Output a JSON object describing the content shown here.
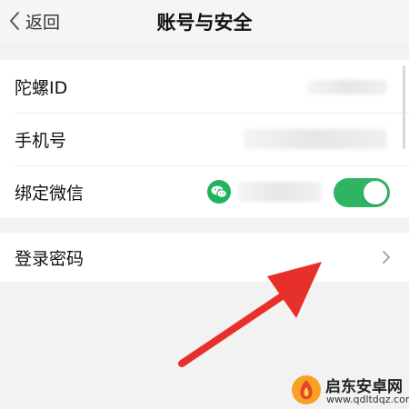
{
  "nav": {
    "back_label": "返回",
    "title": "账号与安全"
  },
  "account": {
    "rows": [
      {
        "label": "陀螺ID"
      },
      {
        "label": "手机号"
      },
      {
        "label": "绑定微信",
        "wechat_bound": true
      }
    ]
  },
  "security": {
    "rows": [
      {
        "label": "登录密码"
      }
    ]
  },
  "watermark": {
    "title": "启东安卓网",
    "url": "www.qdltdqz.com"
  },
  "colors": {
    "toggle_on": "#2fb463",
    "wechat": "#22b35e",
    "arrow": "#e8302b",
    "background": "#f2f2f2"
  },
  "icons": {
    "back": "chevron-left-icon",
    "wechat": "wechat-icon",
    "row_action": "chevron-right-icon"
  }
}
